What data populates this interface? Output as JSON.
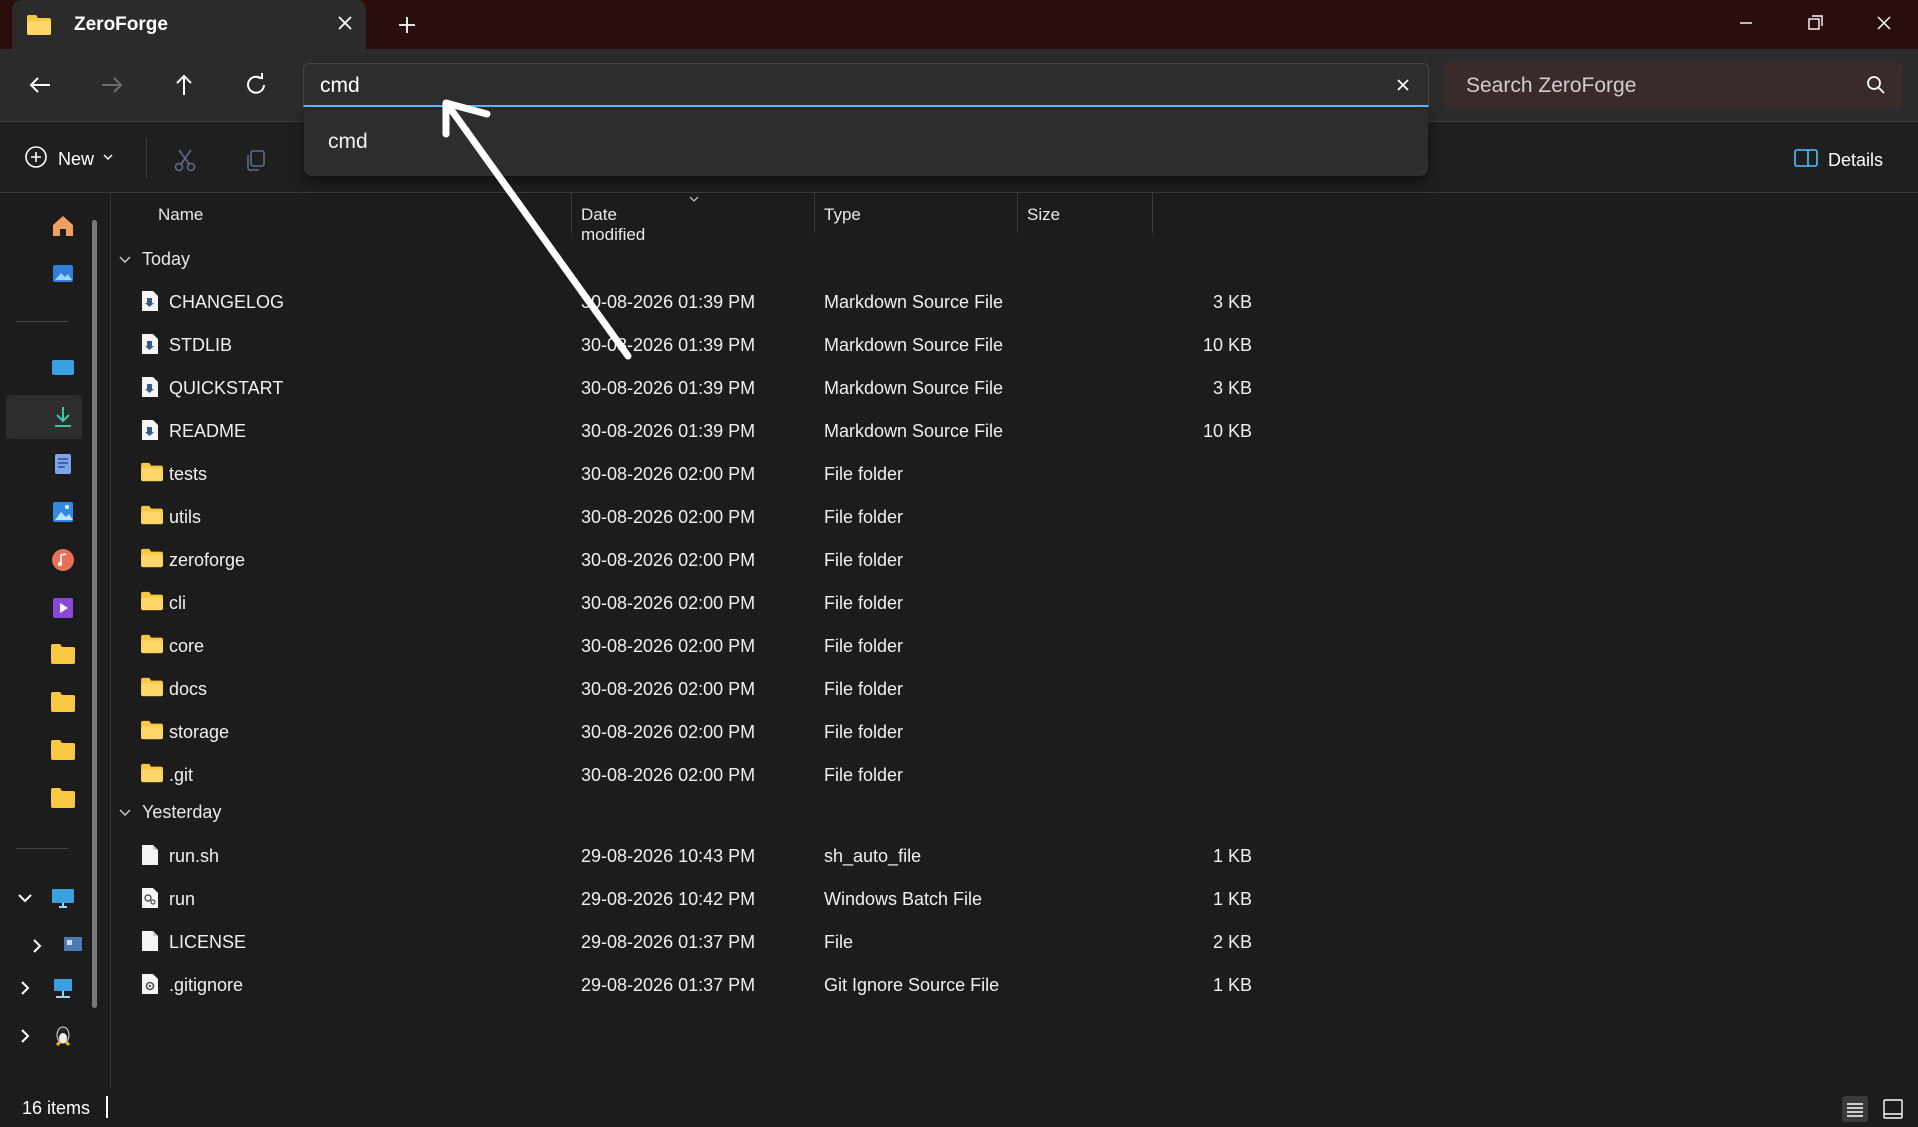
{
  "window": {
    "tab_title": "ZeroForge"
  },
  "address": {
    "value": "cmd",
    "suggestion": "cmd"
  },
  "search": {
    "placeholder": "Search ZeroForge"
  },
  "toolbar": {
    "new_label": "New",
    "details_label": "Details"
  },
  "columns": {
    "name": "Name",
    "date": "Date modified",
    "type": "Type",
    "size": "Size"
  },
  "groups": {
    "today": "Today",
    "yesterday": "Yesterday"
  },
  "files_today": [
    {
      "name": "CHANGELOG",
      "date": "30-08-2026 01:39 PM",
      "type": "Markdown Source File",
      "size": "3 KB",
      "icon": "markdown-file-icon"
    },
    {
      "name": "STDLIB",
      "date": "30-08-2026 01:39 PM",
      "type": "Markdown Source File",
      "size": "10 KB",
      "icon": "markdown-file-icon"
    },
    {
      "name": "QUICKSTART",
      "date": "30-08-2026 01:39 PM",
      "type": "Markdown Source File",
      "size": "3 KB",
      "icon": "markdown-file-icon"
    },
    {
      "name": "README",
      "date": "30-08-2026 01:39 PM",
      "type": "Markdown Source File",
      "size": "10 KB",
      "icon": "markdown-file-icon"
    },
    {
      "name": "tests",
      "date": "30-08-2026 02:00 PM",
      "type": "File folder",
      "size": "",
      "icon": "folder-icon"
    },
    {
      "name": "utils",
      "date": "30-08-2026 02:00 PM",
      "type": "File folder",
      "size": "",
      "icon": "folder-icon"
    },
    {
      "name": "zeroforge",
      "date": "30-08-2026 02:00 PM",
      "type": "File folder",
      "size": "",
      "icon": "folder-icon"
    },
    {
      "name": "cli",
      "date": "30-08-2026 02:00 PM",
      "type": "File folder",
      "size": "",
      "icon": "folder-icon"
    },
    {
      "name": "core",
      "date": "30-08-2026 02:00 PM",
      "type": "File folder",
      "size": "",
      "icon": "folder-icon"
    },
    {
      "name": "docs",
      "date": "30-08-2026 02:00 PM",
      "type": "File folder",
      "size": "",
      "icon": "folder-icon"
    },
    {
      "name": "storage",
      "date": "30-08-2026 02:00 PM",
      "type": "File folder",
      "size": "",
      "icon": "folder-icon"
    },
    {
      "name": ".git",
      "date": "30-08-2026 02:00 PM",
      "type": "File folder",
      "size": "",
      "icon": "folder-icon"
    }
  ],
  "files_yesterday": [
    {
      "name": "run.sh",
      "date": "29-08-2026 10:43 PM",
      "type": "sh_auto_file",
      "size": "1 KB",
      "icon": "file-icon"
    },
    {
      "name": "run",
      "date": "29-08-2026 10:42 PM",
      "type": "Windows Batch File",
      "size": "1 KB",
      "icon": "batch-file-icon"
    },
    {
      "name": "LICENSE",
      "date": "29-08-2026 01:37 PM",
      "type": "File",
      "size": "2 KB",
      "icon": "file-icon"
    },
    {
      "name": ".gitignore",
      "date": "29-08-2026 01:37 PM",
      "type": "Git Ignore Source File",
      "size": "1 KB",
      "icon": "settings-file-icon"
    }
  ],
  "status": {
    "item_count": "16 items"
  },
  "colors": {
    "accent": "#4cc2ff",
    "folder": "#f8c843",
    "titlebar": "#2a0d0d"
  }
}
